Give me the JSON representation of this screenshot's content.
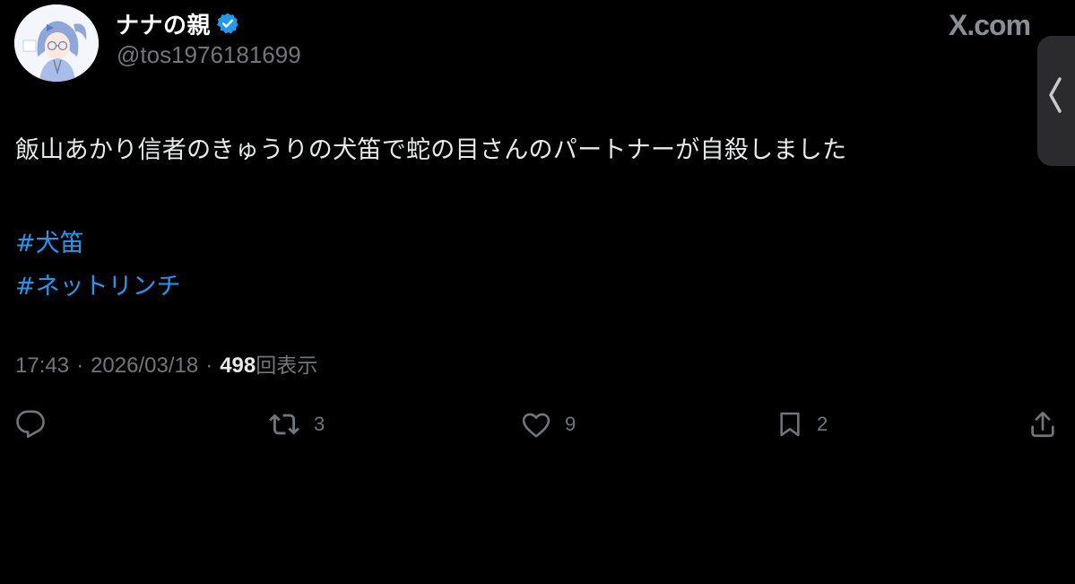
{
  "author": {
    "display_name": "ナナの親",
    "handle": "@tos1976181699",
    "verified": true
  },
  "watermark": "X.com",
  "tweet": {
    "text": "飯山あかり信者のきゅうりの犬笛で蛇の目さんのパートナーが自殺しました",
    "hashtags": [
      "#犬笛",
      "#ネットリンチ"
    ]
  },
  "meta": {
    "time": "17:43",
    "separator": "·",
    "date": "2026/03/18",
    "views_count": "498",
    "views_label": "回表示"
  },
  "actions": {
    "reply_count": "",
    "retweet_count": "3",
    "like_count": "9",
    "bookmark_count": "2"
  },
  "icons": {
    "verified": "verified-badge-icon",
    "reply": "speech-bubble-icon",
    "retweet": "repost-arrows-icon",
    "like": "heart-icon",
    "bookmark": "bookmark-icon",
    "share": "share-upload-icon",
    "side_handle": "chevron-left-icon"
  },
  "colors": {
    "background": "#000000",
    "text": "#e7e9ea",
    "secondary_text": "#71767b",
    "link": "#1d9bf0",
    "verified": "#1d9bf0"
  }
}
